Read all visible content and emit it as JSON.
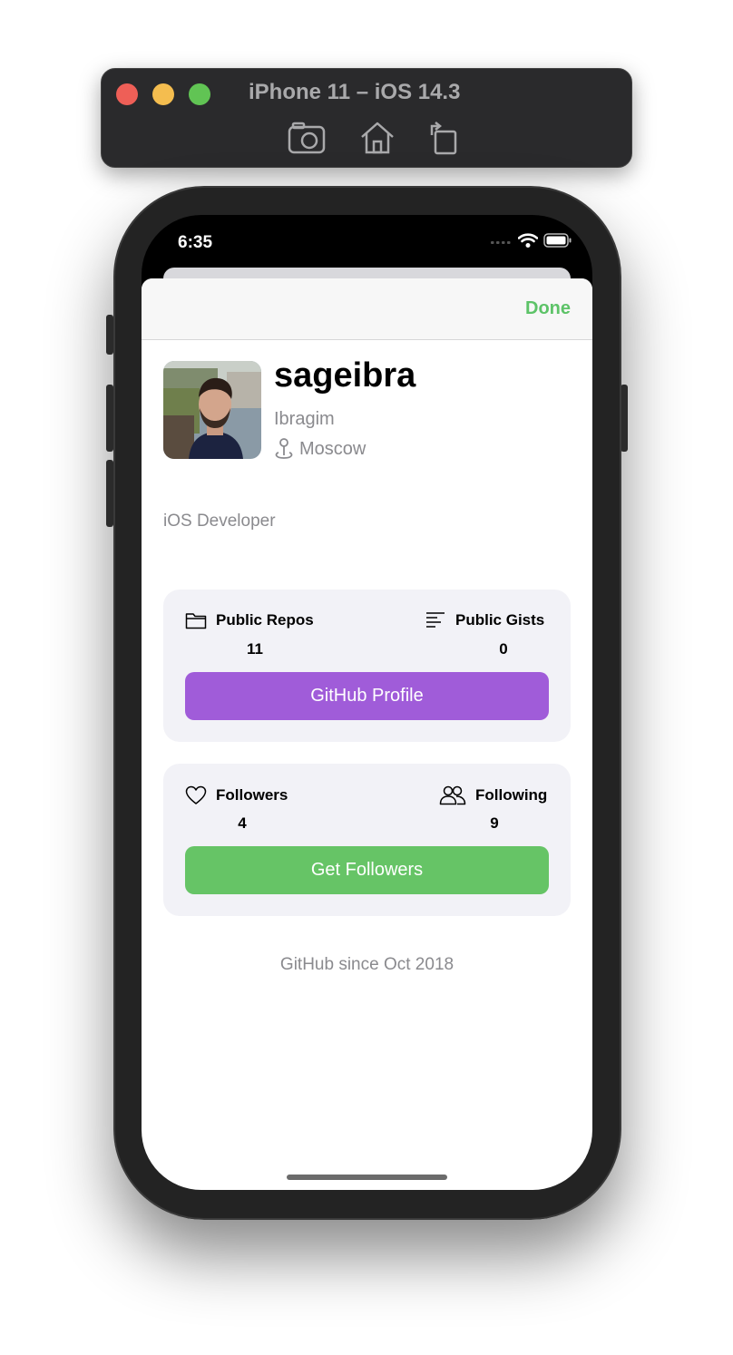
{
  "simulator": {
    "title": "iPhone 11 – iOS 14.3",
    "buttons": [
      "screenshot-icon",
      "home-icon",
      "rotate-icon"
    ]
  },
  "status_bar": {
    "time": "6:35",
    "icons": [
      "signal-icon",
      "wifi-icon",
      "battery-icon"
    ]
  },
  "nav": {
    "done_label": "Done",
    "accent": "#5dc368"
  },
  "profile": {
    "username": "sageibra",
    "name": "Ibragim",
    "location": "Moscow",
    "bio": "iOS Developer"
  },
  "repos_card": {
    "left": {
      "icon": "folder-icon",
      "label": "Public Repos",
      "count": "11"
    },
    "right": {
      "icon": "text-lines-icon",
      "label": "Public Gists",
      "count": "0"
    },
    "button_label": "GitHub Profile",
    "button_color": "#a05cd9"
  },
  "followers_card": {
    "left": {
      "icon": "heart-icon",
      "label": "Followers",
      "count": "4"
    },
    "right": {
      "icon": "people-icon",
      "label": "Following",
      "count": "9"
    },
    "button_label": "Get Followers",
    "button_color": "#66c466"
  },
  "footer": {
    "since": "GitHub since Oct 2018"
  }
}
